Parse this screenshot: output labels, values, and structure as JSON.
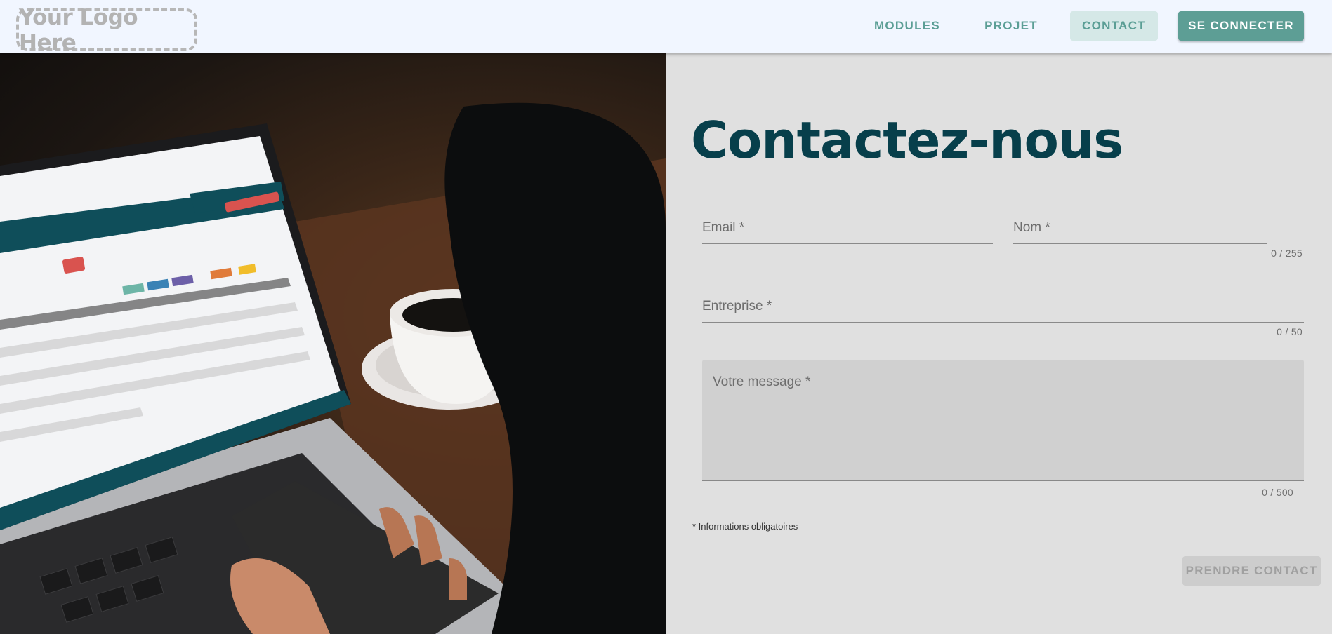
{
  "header": {
    "logo_text": "Your Logo Here",
    "nav": {
      "modules": "MODULES",
      "projet": "PROJET",
      "contact": "CONTACT",
      "login": "SE CONNECTER"
    }
  },
  "form": {
    "title": "Contactez-nous",
    "email_label": "Email *",
    "nom_label": "Nom *",
    "nom_counter": "0 / 255",
    "entreprise_label": "Entreprise *",
    "entreprise_counter": "0 / 50",
    "message_label": "Votre message *",
    "message_counter": "0 / 500",
    "required_note": "* Informations obligatoires",
    "submit_label": "PRENDRE CONTACT"
  },
  "photo": {
    "icon": "hero-photo-laptop-coffee"
  }
}
